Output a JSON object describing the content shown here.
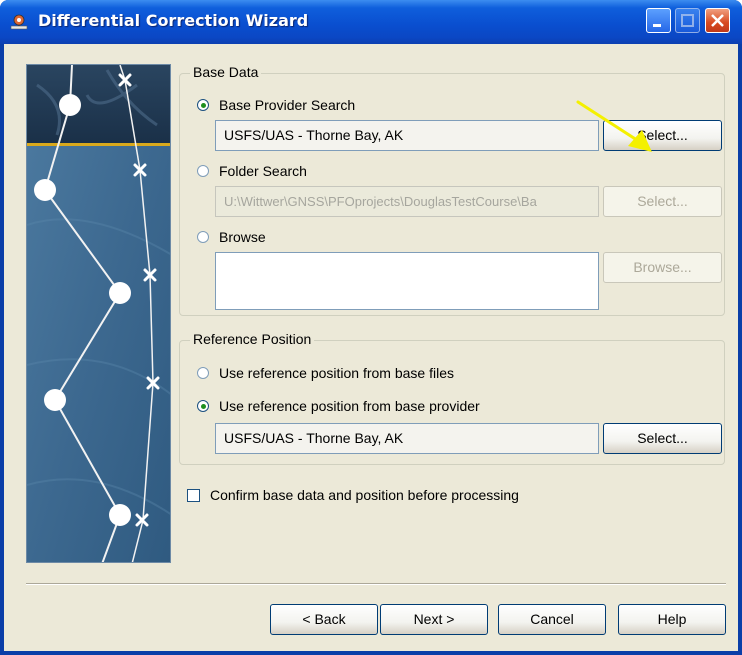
{
  "window": {
    "title": "Differential Correction Wizard"
  },
  "base_data": {
    "legend": "Base Data",
    "provider_search": {
      "label": "Base Provider Search",
      "value": "USFS/UAS - Thorne Bay, AK",
      "select_label": "Select..."
    },
    "folder_search": {
      "label": "Folder Search",
      "value": "U:\\Wittwer\\GNSS\\PFOprojects\\DouglasTestCourse\\Ba",
      "select_label": "Select..."
    },
    "browse": {
      "label": "Browse",
      "value": "",
      "browse_label": "Browse..."
    }
  },
  "reference_position": {
    "legend": "Reference Position",
    "from_files_label": "Use reference position from base files",
    "from_provider_label": "Use reference position from base provider",
    "value": "USFS/UAS - Thorne Bay, AK",
    "select_label": "Select..."
  },
  "confirm_label": "Confirm base data and position before processing",
  "footer": {
    "back": "< Back",
    "next": "Next >",
    "cancel": "Cancel",
    "help": "Help"
  },
  "colors": {
    "title_bar": "#0a4fd0",
    "dialog_bg": "#ece9d8",
    "arrow": "#f4f000",
    "sidebar": "#3f6c93"
  }
}
